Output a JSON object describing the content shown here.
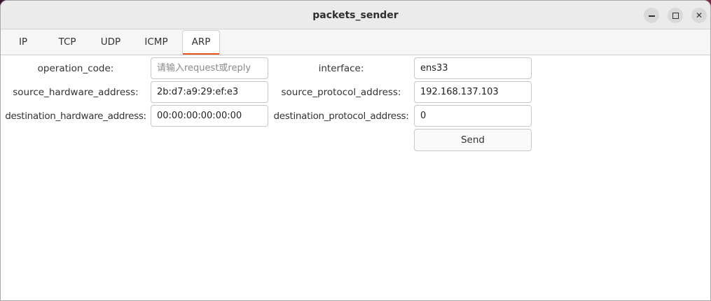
{
  "window": {
    "title": "packets_sender"
  },
  "tabs": [
    {
      "label": "IP"
    },
    {
      "label": "TCP"
    },
    {
      "label": "UDP"
    },
    {
      "label": "ICMP"
    },
    {
      "label": "ARP"
    }
  ],
  "active_tab": "ARP",
  "form": {
    "operation_code": {
      "label": "operation_code:",
      "value": "",
      "placeholder": "请输入request或reply"
    },
    "interface": {
      "label": "interface:",
      "value": "ens33"
    },
    "source_hardware_address": {
      "label": "source_hardware_address:",
      "value": "2b:d7:a9:29:ef:e3"
    },
    "source_protocol_address": {
      "label": "source_protocol_address:",
      "value": "192.168.137.103"
    },
    "destination_hardware_address": {
      "label": "destination_hardware_address:",
      "value": "00:00:00:00:00:00"
    },
    "destination_protocol_address": {
      "label": "destination_protocol_address:",
      "value": "0"
    },
    "send_label": "Send"
  },
  "colors": {
    "accent": "#e95420"
  }
}
